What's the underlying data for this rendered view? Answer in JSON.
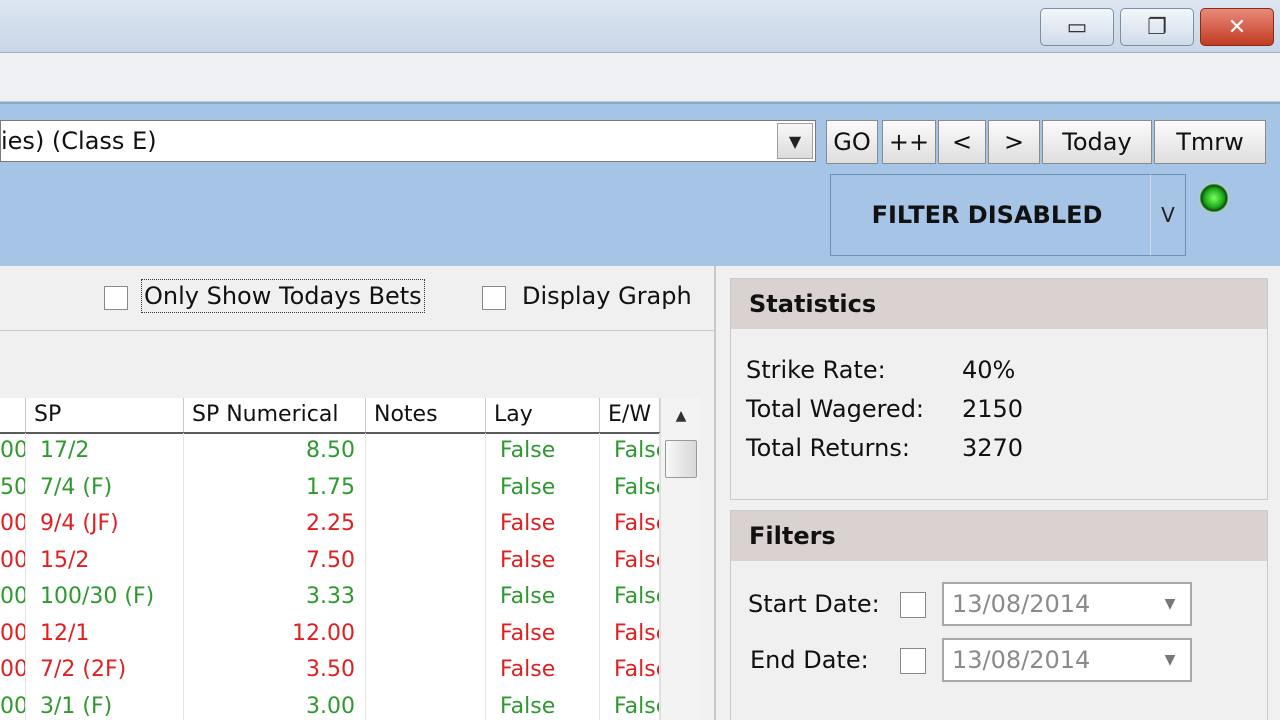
{
  "window": {
    "minimize_glyph": "▭",
    "restore_glyph": "❐",
    "close_glyph": "✕"
  },
  "race_selector": {
    "value": "ies) (Class E)",
    "dropdown_glyph": "▼"
  },
  "nav": {
    "go": "GO",
    "plus": "++",
    "prev": "<",
    "next": ">",
    "today": "Today",
    "tmrw": "Tmrw"
  },
  "filter_status": {
    "label": "FILTER DISABLED",
    "v_label": "V"
  },
  "options": {
    "only_today": "Only Show Todays Bets",
    "display_graph": "Display Graph"
  },
  "grid": {
    "columns": [
      "",
      "SP",
      "SP Numerical",
      "Notes",
      "Lay",
      "E/W"
    ],
    "rows": [
      {
        "lead": "00",
        "sp": "17/2",
        "spn": "8.50",
        "notes": "",
        "lay": "False",
        "ew": "False",
        "status": "win"
      },
      {
        "lead": "50",
        "sp": "7/4 (F)",
        "spn": "1.75",
        "notes": "",
        "lay": "False",
        "ew": "False",
        "status": "win"
      },
      {
        "lead": "00",
        "sp": "9/4 (JF)",
        "spn": "2.25",
        "notes": "",
        "lay": "False",
        "ew": "False",
        "status": "loss"
      },
      {
        "lead": "00",
        "sp": "15/2",
        "spn": "7.50",
        "notes": "",
        "lay": "False",
        "ew": "False",
        "status": "loss"
      },
      {
        "lead": "00",
        "sp": "100/30 (F)",
        "spn": "3.33",
        "notes": "",
        "lay": "False",
        "ew": "False",
        "status": "win"
      },
      {
        "lead": "00",
        "sp": "12/1",
        "spn": "12.00",
        "notes": "",
        "lay": "False",
        "ew": "False",
        "status": "loss"
      },
      {
        "lead": "00",
        "sp": "7/2 (2F)",
        "spn": "3.50",
        "notes": "",
        "lay": "False",
        "ew": "False",
        "status": "loss"
      },
      {
        "lead": "00",
        "sp": "3/1 (F)",
        "spn": "3.00",
        "notes": "",
        "lay": "False",
        "ew": "False",
        "status": "win"
      }
    ],
    "scroll_up_glyph": "▲"
  },
  "colors": {
    "win": "#2e9a2e",
    "loss": "#e02020"
  },
  "statistics": {
    "title": "Statistics",
    "strike_rate_label": "Strike Rate:",
    "strike_rate": "40%",
    "wagered_label": "Total Wagered:",
    "wagered": "2150",
    "returns_label": "Total Returns:",
    "returns": "3270"
  },
  "filters": {
    "title": "Filters",
    "start_label": "Start Date:",
    "start_value": "13/08/2014",
    "end_label": "End Date:",
    "end_value": "13/08/2014",
    "dropdown_glyph": "▼"
  }
}
